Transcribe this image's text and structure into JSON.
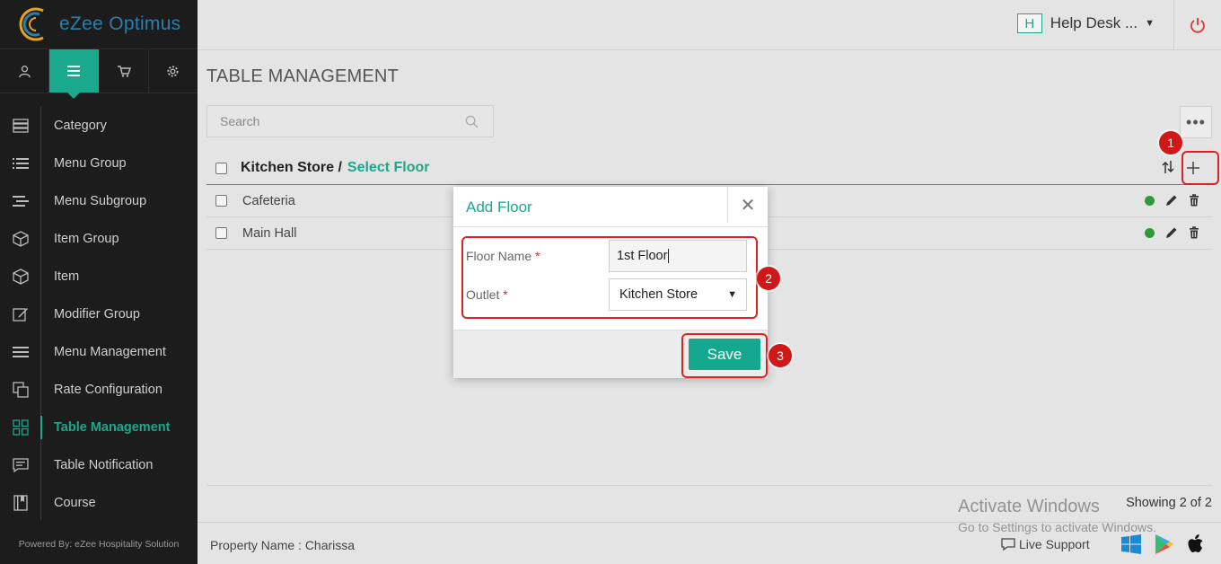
{
  "brand": {
    "name": "eZee Optimus"
  },
  "sidebar": {
    "tabs": [
      {
        "icon": "user-icon"
      },
      {
        "icon": "menu-icon"
      },
      {
        "icon": "cart-icon"
      },
      {
        "icon": "gear-icon"
      }
    ],
    "items": [
      {
        "label": "Category",
        "icon": "category-icon"
      },
      {
        "label": "Menu Group",
        "icon": "list-icon"
      },
      {
        "label": "Menu Subgroup",
        "icon": "sublist-icon"
      },
      {
        "label": "Item Group",
        "icon": "box-icon"
      },
      {
        "label": "Item",
        "icon": "box-icon"
      },
      {
        "label": "Modifier Group",
        "icon": "edit-icon"
      },
      {
        "label": "Menu Management",
        "icon": "bars-icon"
      },
      {
        "label": "Rate Configuration",
        "icon": "copy-icon"
      },
      {
        "label": "Table Management",
        "icon": "grid-icon",
        "active": true
      },
      {
        "label": "Table Notification",
        "icon": "comment-icon"
      },
      {
        "label": "Course",
        "icon": "book-icon"
      }
    ],
    "powered_by": "Powered By: eZee Hospitality Solution"
  },
  "topbar": {
    "help_badge": "H",
    "help_desk": "Help Desk ..."
  },
  "page": {
    "title": "TABLE MANAGEMENT",
    "search_placeholder": "Search",
    "more_label": "•••",
    "breadcrumb_store": "Kitchen Store /",
    "breadcrumb_select": "Select Floor",
    "rows": [
      {
        "label": "Cafeteria"
      },
      {
        "label": "Main Hall"
      }
    ],
    "showing": "Showing 2 of 2"
  },
  "footer": {
    "property": "Property Name : Charissa",
    "live_support": "Live Support"
  },
  "modal": {
    "title": "Add Floor",
    "floor_name_label": "Floor Name",
    "floor_name_value": "1st Floor",
    "outlet_label": "Outlet",
    "outlet_value": "Kitchen Store",
    "required_mark": "*",
    "save_label": "Save"
  },
  "annotations": {
    "step1": "1",
    "step2": "2",
    "step3": "3",
    "color": "#d22222"
  },
  "watermark": {
    "line1": "Activate Windows",
    "line2": "Go to Settings to activate Windows."
  },
  "colors": {
    "accent": "#1aa98d",
    "sidebar_bg": "#1c1c1c",
    "status_active": "#2e9b38"
  }
}
